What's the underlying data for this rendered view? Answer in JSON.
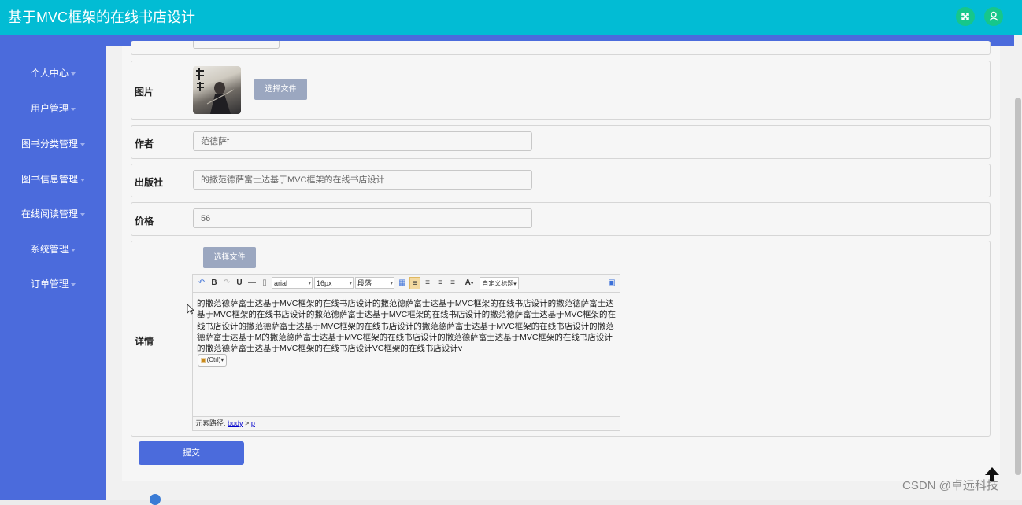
{
  "app": {
    "title": "基于MVC框架的在线书店设计"
  },
  "header_icons": [
    "fullscreen-icon",
    "user-icon"
  ],
  "sidebar": {
    "items": [
      {
        "label": "个人中心"
      },
      {
        "label": "用户管理"
      },
      {
        "label": "图书分类管理"
      },
      {
        "label": "图书信息管理"
      },
      {
        "label": "在线阅读管理"
      },
      {
        "label": "系统管理"
      },
      {
        "label": "订单管理"
      }
    ]
  },
  "form": {
    "image": {
      "label": "图片",
      "file_button": "选择文件"
    },
    "author": {
      "label": "作者",
      "value": "范德萨f"
    },
    "publisher": {
      "label": "出版社",
      "value": "的撒范德萨富士达基于MVC框架的在线书店设计"
    },
    "price": {
      "label": "价格",
      "value": "56"
    },
    "detail": {
      "label": "详情",
      "file_button": "选择文件",
      "toolbar": {
        "bold": "B",
        "italic": "I",
        "underline": "U",
        "font_family": "arial",
        "font_size": "16px",
        "paragraph": "段落",
        "font_color": "A",
        "custom_heading": "自定义标题"
      },
      "content": "的撒范德萨富士达基于MVC框架的在线书店设计的撒范德萨富士达基于MVC框架的在线书店设计的撒范德萨富士达基于MVC框架的在线书店设计的撒范德萨富士达基于MVC框架的在线书店设计的撒范德萨富士达基于MVC框架的在线书店设计的撒范德萨富士达基于MVC框架的在线书店设计的撒范德萨富士达基于MVC框架的在线书店设计的撒范德萨富士达基于M的撒范德萨富士达基于MVC框架的在线书店设计的撒范德萨富士达基于MVC框架的在线书店设计的撒范德萨富士达基于MVC框架的在线书店设计VC框架的在线书店设计v",
      "paste_badge": "(Ctrl)",
      "path_label": "元素路径:",
      "path_body": "body",
      "path_sep": ">",
      "path_p": "p"
    },
    "submit_label": "提交"
  },
  "watermark": "CSDN @卓远科技",
  "colors": {
    "header": "#02bcd4",
    "sidebar": "#4b6bdc",
    "header_button": "#16c78a",
    "file_button": "#9ba7c0"
  }
}
